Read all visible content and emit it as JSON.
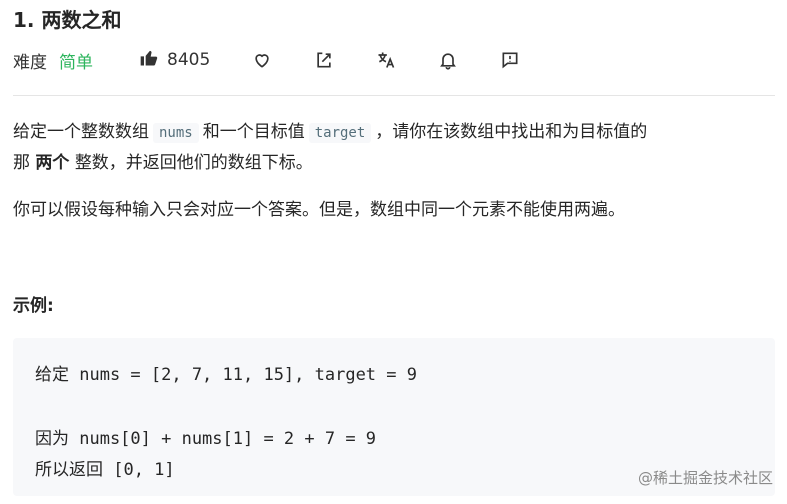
{
  "problem": {
    "title": "1. 两数之和",
    "difficulty_label": "难度",
    "difficulty_value": "简单",
    "likes": "8405"
  },
  "description": {
    "p1_a": "给定一个整数数组",
    "p1_code1": "nums",
    "p1_b": "和一个目标值",
    "p1_code2": "target",
    "p1_c": "，请你在该数组中找出和为目标值的",
    "p1_d": "那",
    "p1_bold": "两个",
    "p1_e": "整数，并返回他们的数组下标。",
    "p2": "你可以假设每种输入只会对应一个答案。但是，数组中同一个元素不能使用两遍。"
  },
  "example": {
    "heading": "示例:",
    "line1": "给定 nums = [2, 7, 11, 15], target = 9",
    "line2": "因为 nums[0] + nums[1] = 2 + 7 = 9",
    "line3": "所以返回 [0, 1]"
  },
  "watermark": "@稀土掘金技术社区",
  "icons": [
    "thumbs-up-icon",
    "heart-icon",
    "share-icon",
    "translate-icon",
    "bell-icon",
    "feedback-icon"
  ],
  "colors": {
    "difficulty_easy": "#2db55d",
    "code_bg": "#f7f8fa"
  }
}
